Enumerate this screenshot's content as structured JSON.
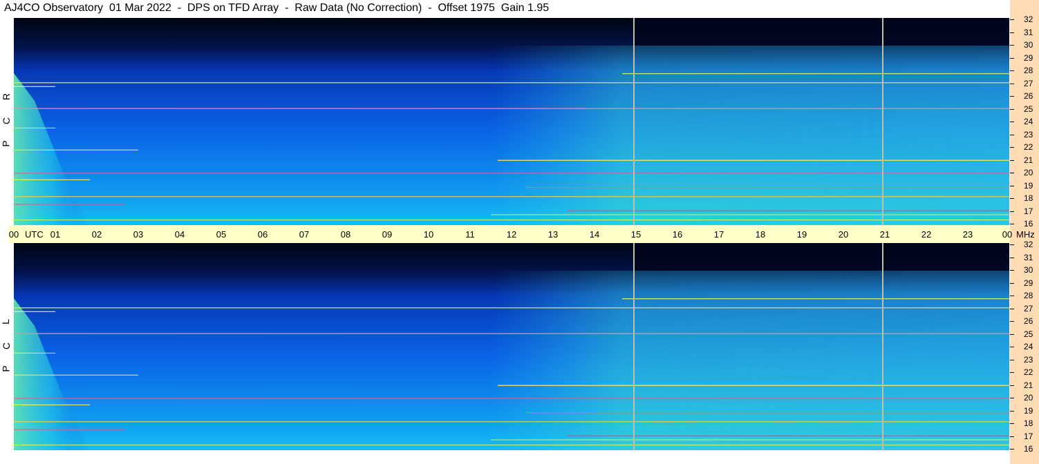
{
  "title": "AJ4CO Observatory  01 Mar 2022  -  DPS on TFD Array  -  Raw Data (No Correction)  -  Offset 1975  Gain 1.95",
  "panels": [
    {
      "name": "rcp",
      "letters": [
        "R",
        "C",
        "P"
      ]
    },
    {
      "name": "lcp",
      "letters": [
        "L",
        "C",
        "P"
      ]
    }
  ],
  "chart_data": {
    "type": "heatmap",
    "title": "AJ4CO Observatory  01 Mar 2022  -  DPS on TFD Array  -  Raw Data (No Correction)  -  Offset 1975  Gain 1.95",
    "x_ticks": [
      "00",
      "01",
      "02",
      "03",
      "04",
      "05",
      "06",
      "07",
      "08",
      "09",
      "10",
      "11",
      "12",
      "13",
      "14",
      "15",
      "16",
      "17",
      "18",
      "19",
      "20",
      "21",
      "22",
      "23",
      "00"
    ],
    "x_unit": "UTC",
    "x_range_hours": [
      0,
      24
    ],
    "y_ticks": [
      "32",
      "31",
      "30",
      "29",
      "28",
      "27",
      "26",
      "25",
      "24",
      "23",
      "22",
      "21",
      "20",
      "19",
      "18",
      "17",
      "16"
    ],
    "y_unit": "MHz",
    "y_range_mhz": [
      16,
      32
    ],
    "marker_times_hours": [
      14.95,
      20.95
    ],
    "panel_labels": [
      "RCP",
      "LCP"
    ],
    "colors": {
      "low": "#000010",
      "mid": "#0a50e6",
      "high": "#14c8f0",
      "hot": "#e8ff50",
      "interference": "#ff60a0",
      "marker": "#c0c0a8"
    }
  }
}
